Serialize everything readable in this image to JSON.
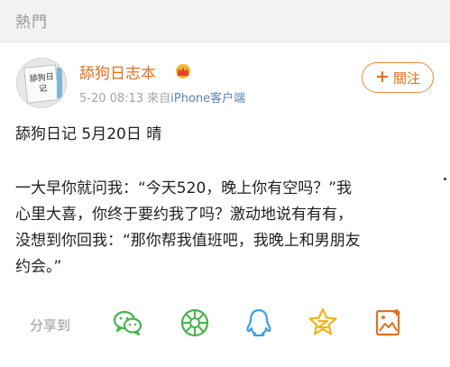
{
  "header": {
    "title": "熱門"
  },
  "post": {
    "avatar_text": "舔狗日记",
    "username": "舔狗日志本",
    "timestamp": "5-20 08:13",
    "source_prefix": "來自",
    "source": "iPhone客户端",
    "follow_label": "關注",
    "follow_icon": "plus-icon",
    "lines": [
      "舔狗日记 5月20日 晴",
      "一大早你就问我：“今天520，晚上你有空吗？”我",
      "心里大喜，你终于要约我了吗？激动地说有有有，",
      "没想到你回我：“那你帮我值班吧，我晚上和男朋友",
      "约会。”"
    ]
  },
  "share": {
    "label": "分享到",
    "targets": [
      "wechat-icon",
      "moments-icon",
      "qq-icon",
      "qzone-icon",
      "weibo-pic-icon"
    ]
  },
  "colors": {
    "accent": "#e3701e",
    "green": "#44b549",
    "blue": "#3aa0e6",
    "yellow": "#f2b318"
  }
}
